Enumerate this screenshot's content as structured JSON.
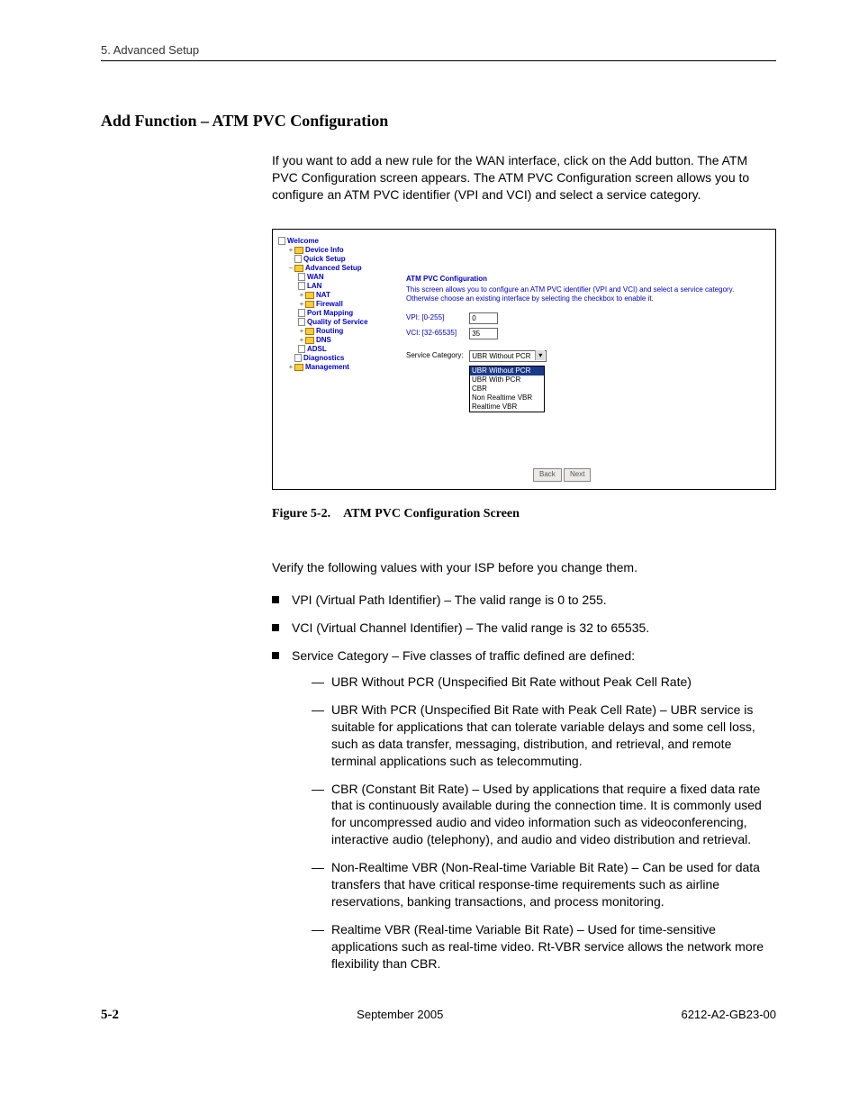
{
  "header": {
    "chapter": "5. Advanced Setup"
  },
  "section": {
    "title": "Add Function – ATM PVC Configuration",
    "intro": "If you want to add a new rule for the WAN interface, click on the Add button. The ATM PVC Configuration screen appears. The ATM PVC Configuration screen allows you to configure an ATM PVC identifier (VPI and VCI) and select a service category."
  },
  "screenshot": {
    "sidebar": {
      "items": [
        {
          "label": "Welcome",
          "level": 0,
          "type": "root"
        },
        {
          "label": "Device Info",
          "level": 1,
          "type": "folder",
          "exp": "+"
        },
        {
          "label": "Quick Setup",
          "level": 1,
          "type": "page"
        },
        {
          "label": "Advanced Setup",
          "level": 1,
          "type": "folder",
          "exp": "–"
        },
        {
          "label": "WAN",
          "level": 2,
          "type": "page"
        },
        {
          "label": "LAN",
          "level": 2,
          "type": "page"
        },
        {
          "label": "NAT",
          "level": 2,
          "type": "folder",
          "exp": "+"
        },
        {
          "label": "Firewall",
          "level": 2,
          "type": "folder",
          "exp": "+"
        },
        {
          "label": "Port Mapping",
          "level": 2,
          "type": "page"
        },
        {
          "label": "Quality of Service",
          "level": 2,
          "type": "page"
        },
        {
          "label": "Routing",
          "level": 2,
          "type": "folder",
          "exp": "+"
        },
        {
          "label": "DNS",
          "level": 2,
          "type": "folder",
          "exp": "+"
        },
        {
          "label": "ADSL",
          "level": 2,
          "type": "page"
        },
        {
          "label": "Diagnostics",
          "level": 1,
          "type": "page"
        },
        {
          "label": "Management",
          "level": 1,
          "type": "folder",
          "exp": "+"
        }
      ]
    },
    "main": {
      "title": "ATM PVC Configuration",
      "help": "This screen allows you to configure an ATM PVC identifier (VPI and VCI) and select a service category. Otherwise choose an existing interface by selecting the checkbox to enable it.",
      "vpi_label": "VPI: [0-255]",
      "vpi_value": "0",
      "vci_label": "VCI: [32-65535]",
      "vci_value": "35",
      "svc_label": "Service Category:",
      "svc_selected": "UBR Without PCR",
      "svc_options": [
        "UBR Without PCR",
        "UBR With PCR",
        "CBR",
        "Non Realtime VBR",
        "Realtime VBR"
      ],
      "buttons": {
        "back": "Back",
        "next": "Next"
      }
    }
  },
  "figure": {
    "label": "Figure 5-2.",
    "title": "ATM PVC Configuration Screen"
  },
  "verify": "Verify the following values with your ISP before you change them.",
  "bullets": {
    "vpi": "VPI (Virtual Path Identifier) – The valid range is 0 to 255.",
    "vci": "VCI  (Virtual Channel Identifier) – The valid range is 32 to 65535.",
    "svc_intro": "Service Category – Five classes of traffic defined are defined:",
    "svc_items": {
      "ubr_wo": "UBR Without PCR (Unspecified Bit Rate without Peak Cell Rate)",
      "ubr_w": "UBR With PCR (Unspecified Bit Rate with Peak Cell Rate) – UBR service is suitable for applications that can tolerate variable delays and some cell loss, such as data transfer, messaging, distribution, and retrieval, and remote terminal applications such as telecommuting.",
      "cbr": "CBR (Constant Bit Rate) – Used by applications that require a fixed data rate that is continuously available during the connection time. It is commonly used for uncompressed audio and video information such as videoconferencing, interactive audio (telephony), and audio and video distribution and retrieval.",
      "nrtvbr": "Non-Realtime VBR (Non-Real-time Variable Bit Rate) – Can be used for data transfers that have critical response-time requirements such as airline reservations, banking transactions, and process monitoring.",
      "rtvbr": "Realtime VBR  (Real-time Variable Bit Rate) – Used for time-sensitive applications such as real-time video. Rt-VBR service allows the network more flexibility than CBR."
    }
  },
  "footer": {
    "page": "5-2",
    "date": "September 2005",
    "docnum": "6212-A2-GB23-00"
  }
}
